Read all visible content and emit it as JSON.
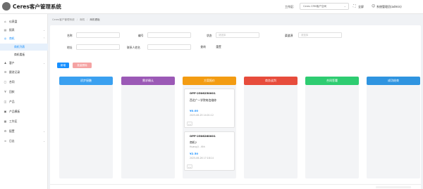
{
  "app": {
    "title": "Ceres客户管理系统"
  },
  "header": {
    "workspace_label": "工作区:",
    "workspace_value": "Ceres CRM客户空间",
    "icon_action_label": "全屏",
    "user_label": "系统管理员(admin)"
  },
  "sidebar": {
    "items": [
      {
        "label": "仪表盘",
        "icon": "dashboard-icon",
        "glyph": "⌂"
      },
      {
        "label": "报表",
        "icon": "chart-icon",
        "glyph": "▤",
        "arrow": "⌄"
      },
      {
        "label": "商机",
        "icon": "opportunity-icon",
        "glyph": "◎",
        "arrow": "⌃"
      },
      {
        "label": "商机列表",
        "sub": true,
        "active": true
      },
      {
        "label": "商机看板",
        "sub": true
      },
      {
        "label": "客户",
        "icon": "customer-icon",
        "glyph": "♟",
        "arrow": "⌄"
      },
      {
        "label": "跟进记录",
        "icon": "followup-icon",
        "glyph": "☰"
      },
      {
        "label": "合同",
        "icon": "contract-icon",
        "glyph": "▢"
      },
      {
        "label": "回款",
        "icon": "payment-icon",
        "glyph": "¥"
      },
      {
        "label": "产品",
        "icon": "product-icon",
        "glyph": "◫"
      },
      {
        "label": "产品模板",
        "icon": "template-icon",
        "glyph": "▣"
      },
      {
        "label": "工作区",
        "icon": "workspace-icon",
        "glyph": "▦"
      },
      {
        "label": "配置",
        "icon": "settings-icon",
        "glyph": "⚙",
        "arrow": "⌄"
      },
      {
        "label": "日志",
        "icon": "log-icon",
        "glyph": "≡",
        "arrow": "⌄"
      }
    ]
  },
  "breadcrumb": [
    "Ceres客户管理系统",
    "商机",
    "商机看板"
  ],
  "filters": {
    "name_label": "名称",
    "number_label": "编号",
    "status_label": "状态",
    "status_placeholder": "请选择",
    "channel_label": "渠道源",
    "channel_placeholder": "请选择",
    "address_label": "地址",
    "contact_label": "联系人姓名",
    "search_label": "查询",
    "reset_label": "重置"
  },
  "actions": {
    "add_label": "新增",
    "batch_label": "批量删除"
  },
  "colors": {
    "stage1": "#3aa0f0",
    "stage2": "#9b59b6",
    "stage3": "#f39c12",
    "stage4": "#e74c3c",
    "stage5": "#2ecc71",
    "stage6": "#2f94e0",
    "accent": "#1890ff"
  },
  "stages": [
    {
      "label": "初步接触"
    },
    {
      "label": "需求确认"
    },
    {
      "label": "方案报价"
    },
    {
      "label": "商务谈判"
    },
    {
      "label": "合同签署"
    },
    {
      "label": "成功结束"
    }
  ],
  "cards": [
    {
      "code": "OPP-2506250001",
      "name": "西北广一学院电信维修",
      "amount": "¥0.00",
      "date": "2025-06-25 14:01:12",
      "more": "..."
    },
    {
      "code": "OPP-2506260001",
      "name": "商机2",
      "contact": "Huang Ji - 6th",
      "amount": "¥2.50",
      "date": "2025-06-26 17:18:14",
      "more": "..."
    }
  ]
}
